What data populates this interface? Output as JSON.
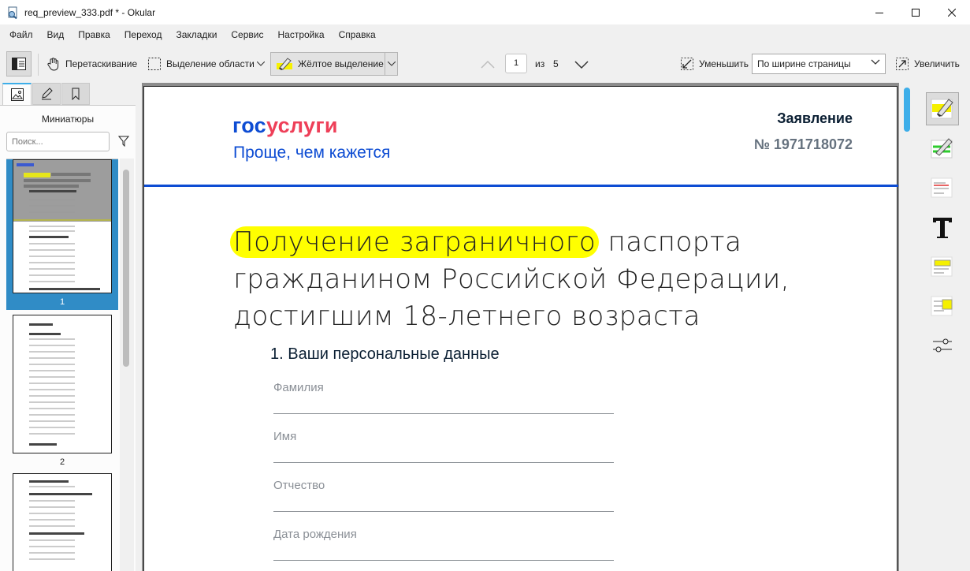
{
  "window": {
    "title": "req_preview_333.pdf * - Okular"
  },
  "menu": [
    {
      "id": "file",
      "label": "Файл"
    },
    {
      "id": "view",
      "label": "Вид"
    },
    {
      "id": "edit",
      "label": "Правка"
    },
    {
      "id": "go",
      "label": "Переход"
    },
    {
      "id": "bookmarks",
      "label": "Закладки"
    },
    {
      "id": "tools",
      "label": "Сервис"
    },
    {
      "id": "settings",
      "label": "Настройка"
    },
    {
      "id": "help",
      "label": "Справка"
    }
  ],
  "toolbar": {
    "browse_label": "Перетаскивание",
    "area_select_label": "Выделение области",
    "highlight_label": "Жёлтое выделение",
    "page_current": "1",
    "page_of": "из",
    "page_total": "5",
    "zoom_out_label": "Уменьшить",
    "zoom_mode": "По ширине страницы",
    "zoom_in_label": "Увеличить"
  },
  "left_panel": {
    "title": "Миниатюры",
    "search_placeholder": "Поиск...",
    "thumbnails": [
      {
        "label": "1",
        "selected": true
      },
      {
        "label": "2",
        "selected": false
      }
    ]
  },
  "document": {
    "logo_part1": "гос",
    "logo_part2": "услуги",
    "tagline": "Проще, чем кажется",
    "doc_type": "Заявление",
    "doc_number": "№ 1971718072",
    "heading_highlighted": "Получение заграничного",
    "heading_rest_line1": " паспорта",
    "heading_line2": "гражданином Российской Федерации,",
    "heading_line3": "достигшим 18-летнего возраста",
    "section_title": "1. Ваши персональные данные",
    "fields": [
      "Фамилия",
      "Имя",
      "Отчество",
      "Дата рождения"
    ]
  },
  "colors": {
    "accent": "#3daee9",
    "selection": "#308cc6",
    "gosuslugi_blue": "#0d4cd3",
    "gosuslugi_red": "#ee3f58",
    "highlight": "#ffff00"
  },
  "annotation_tools": [
    {
      "id": "yellow-highlighter",
      "icon": "highlighter-icon",
      "active": true
    },
    {
      "id": "green-pencil",
      "icon": "green-pencil-icon",
      "active": false
    },
    {
      "id": "red-underline",
      "icon": "underline-icon",
      "active": false
    },
    {
      "id": "typewriter",
      "icon": "typewriter-icon",
      "active": false
    },
    {
      "id": "inline-note",
      "icon": "inline-note-icon",
      "active": false
    },
    {
      "id": "popup-note",
      "icon": "popup-note-icon",
      "active": false
    },
    {
      "id": "quick-tools-config",
      "icon": "sliders-icon",
      "active": false
    }
  ]
}
